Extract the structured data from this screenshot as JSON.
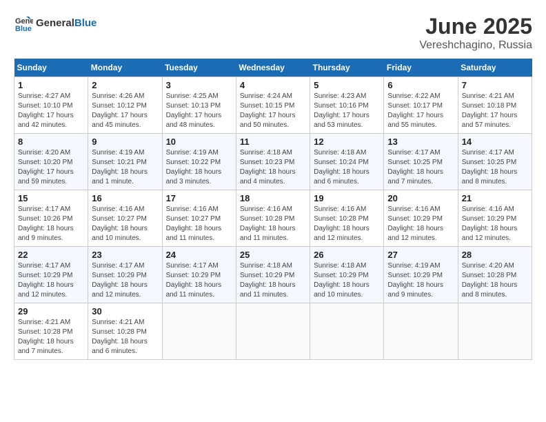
{
  "logo": {
    "general": "General",
    "blue": "Blue"
  },
  "title": "June 2025",
  "subtitle": "Vereshchagino, Russia",
  "days_of_week": [
    "Sunday",
    "Monday",
    "Tuesday",
    "Wednesday",
    "Thursday",
    "Friday",
    "Saturday"
  ],
  "weeks": [
    [
      {
        "day": "1",
        "info": "Sunrise: 4:27 AM\nSunset: 10:10 PM\nDaylight: 17 hours\nand 42 minutes."
      },
      {
        "day": "2",
        "info": "Sunrise: 4:26 AM\nSunset: 10:12 PM\nDaylight: 17 hours\nand 45 minutes."
      },
      {
        "day": "3",
        "info": "Sunrise: 4:25 AM\nSunset: 10:13 PM\nDaylight: 17 hours\nand 48 minutes."
      },
      {
        "day": "4",
        "info": "Sunrise: 4:24 AM\nSunset: 10:15 PM\nDaylight: 17 hours\nand 50 minutes."
      },
      {
        "day": "5",
        "info": "Sunrise: 4:23 AM\nSunset: 10:16 PM\nDaylight: 17 hours\nand 53 minutes."
      },
      {
        "day": "6",
        "info": "Sunrise: 4:22 AM\nSunset: 10:17 PM\nDaylight: 17 hours\nand 55 minutes."
      },
      {
        "day": "7",
        "info": "Sunrise: 4:21 AM\nSunset: 10:18 PM\nDaylight: 17 hours\nand 57 minutes."
      }
    ],
    [
      {
        "day": "8",
        "info": "Sunrise: 4:20 AM\nSunset: 10:20 PM\nDaylight: 17 hours\nand 59 minutes."
      },
      {
        "day": "9",
        "info": "Sunrise: 4:19 AM\nSunset: 10:21 PM\nDaylight: 18 hours\nand 1 minute."
      },
      {
        "day": "10",
        "info": "Sunrise: 4:19 AM\nSunset: 10:22 PM\nDaylight: 18 hours\nand 3 minutes."
      },
      {
        "day": "11",
        "info": "Sunrise: 4:18 AM\nSunset: 10:23 PM\nDaylight: 18 hours\nand 4 minutes."
      },
      {
        "day": "12",
        "info": "Sunrise: 4:18 AM\nSunset: 10:24 PM\nDaylight: 18 hours\nand 6 minutes."
      },
      {
        "day": "13",
        "info": "Sunrise: 4:17 AM\nSunset: 10:25 PM\nDaylight: 18 hours\nand 7 minutes."
      },
      {
        "day": "14",
        "info": "Sunrise: 4:17 AM\nSunset: 10:25 PM\nDaylight: 18 hours\nand 8 minutes."
      }
    ],
    [
      {
        "day": "15",
        "info": "Sunrise: 4:17 AM\nSunset: 10:26 PM\nDaylight: 18 hours\nand 9 minutes."
      },
      {
        "day": "16",
        "info": "Sunrise: 4:16 AM\nSunset: 10:27 PM\nDaylight: 18 hours\nand 10 minutes."
      },
      {
        "day": "17",
        "info": "Sunrise: 4:16 AM\nSunset: 10:27 PM\nDaylight: 18 hours\nand 11 minutes."
      },
      {
        "day": "18",
        "info": "Sunrise: 4:16 AM\nSunset: 10:28 PM\nDaylight: 18 hours\nand 11 minutes."
      },
      {
        "day": "19",
        "info": "Sunrise: 4:16 AM\nSunset: 10:28 PM\nDaylight: 18 hours\nand 12 minutes."
      },
      {
        "day": "20",
        "info": "Sunrise: 4:16 AM\nSunset: 10:29 PM\nDaylight: 18 hours\nand 12 minutes."
      },
      {
        "day": "21",
        "info": "Sunrise: 4:16 AM\nSunset: 10:29 PM\nDaylight: 18 hours\nand 12 minutes."
      }
    ],
    [
      {
        "day": "22",
        "info": "Sunrise: 4:17 AM\nSunset: 10:29 PM\nDaylight: 18 hours\nand 12 minutes."
      },
      {
        "day": "23",
        "info": "Sunrise: 4:17 AM\nSunset: 10:29 PM\nDaylight: 18 hours\nand 12 minutes."
      },
      {
        "day": "24",
        "info": "Sunrise: 4:17 AM\nSunset: 10:29 PM\nDaylight: 18 hours\nand 11 minutes."
      },
      {
        "day": "25",
        "info": "Sunrise: 4:18 AM\nSunset: 10:29 PM\nDaylight: 18 hours\nand 11 minutes."
      },
      {
        "day": "26",
        "info": "Sunrise: 4:18 AM\nSunset: 10:29 PM\nDaylight: 18 hours\nand 10 minutes."
      },
      {
        "day": "27",
        "info": "Sunrise: 4:19 AM\nSunset: 10:29 PM\nDaylight: 18 hours\nand 9 minutes."
      },
      {
        "day": "28",
        "info": "Sunrise: 4:20 AM\nSunset: 10:28 PM\nDaylight: 18 hours\nand 8 minutes."
      }
    ],
    [
      {
        "day": "29",
        "info": "Sunrise: 4:21 AM\nSunset: 10:28 PM\nDaylight: 18 hours\nand 7 minutes."
      },
      {
        "day": "30",
        "info": "Sunrise: 4:21 AM\nSunset: 10:28 PM\nDaylight: 18 hours\nand 6 minutes."
      },
      {
        "day": "",
        "info": ""
      },
      {
        "day": "",
        "info": ""
      },
      {
        "day": "",
        "info": ""
      },
      {
        "day": "",
        "info": ""
      },
      {
        "day": "",
        "info": ""
      }
    ]
  ]
}
